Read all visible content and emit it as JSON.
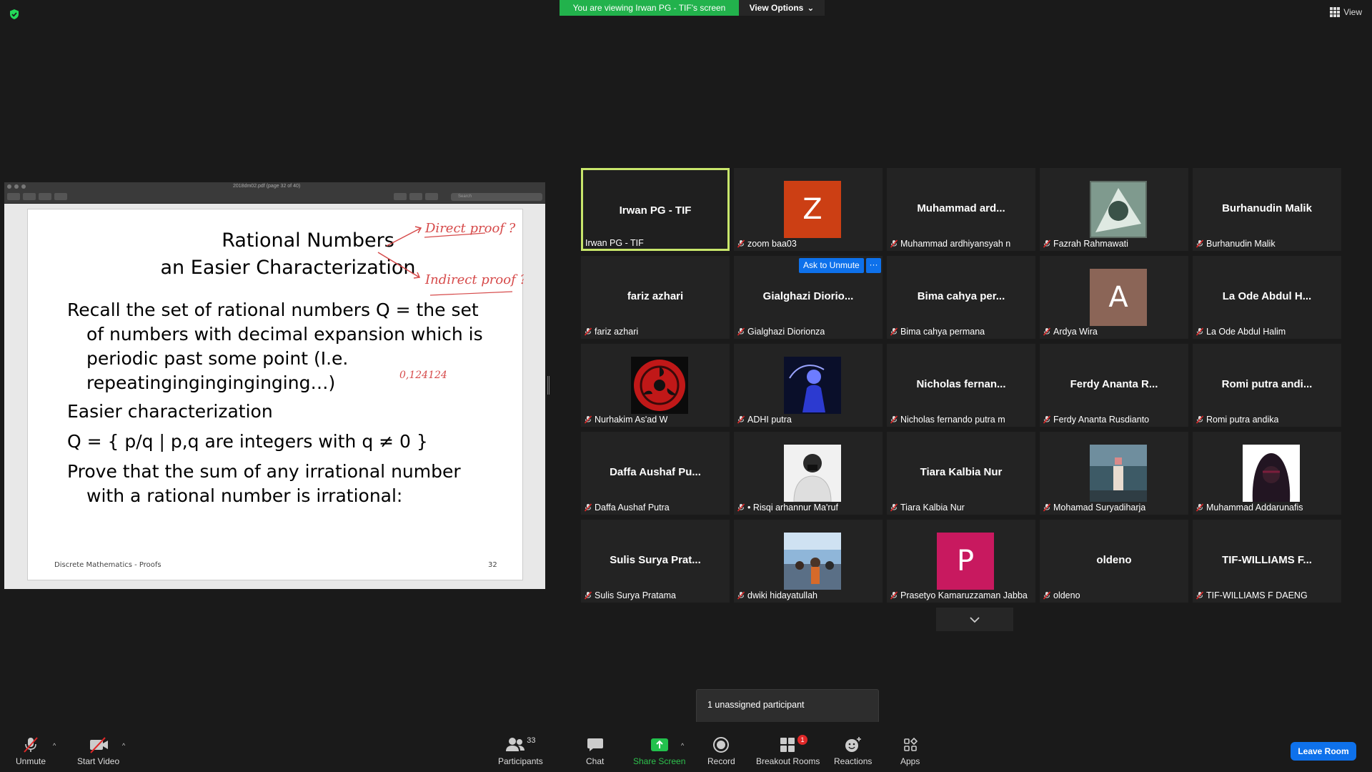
{
  "top": {
    "viewing_banner": "You are viewing Irwan PG - TIF's screen",
    "view_options": "View Options",
    "view": "View"
  },
  "share": {
    "pdf_title": "2018dm02.pdf (page 32 of 40)",
    "pdf_search_placeholder": "Search",
    "slide": {
      "title_line1": "Rational Numbers",
      "title_line2": "an Easier Characterization",
      "lines": [
        "Recall the set of rational numbers Q = the set",
        "of numbers with decimal expansion which is",
        "periodic past some point (I.e.",
        "repeatinginginginginging…)",
        "Easier characterization",
        "Q = { p/q  |  p,q are integers with q ≠ 0 }",
        "Prove that the sum of any irrational number",
        "with a rational number is irrational:"
      ],
      "footer": "Discrete Mathematics - Proofs",
      "page": "32",
      "annotations": [
        "Direct proof ?",
        "Indirect proof ?",
        "0,124124"
      ]
    }
  },
  "gallery": {
    "ask_unmute": "Ask to Unmute",
    "more": "···",
    "tiles": [
      {
        "big": "Irwan PG - TIF",
        "label": "Irwan PG - TIF",
        "muted": false
      },
      {
        "big": "",
        "label": "zoom baa03",
        "avatar": "Z",
        "color": "#cc3f14"
      },
      {
        "big": "Muhammad  ard...",
        "label": "Muhammad ardhiyansyah n"
      },
      {
        "big": "",
        "label": "Fazrah Rahmawati",
        "photo": "art"
      },
      {
        "big": "Burhanudin Malik",
        "label": "Burhanudin Malik"
      },
      {
        "big": "fariz azhari",
        "label": "fariz azhari"
      },
      {
        "big": "Gialghazi  Diorio...",
        "label": "Gialghazi Diorionza"
      },
      {
        "big": "Bima  cahya  per...",
        "label": "Bima cahya permana"
      },
      {
        "big": "",
        "label": "Ardya Wira",
        "avatar": "A",
        "color": "#8b6557"
      },
      {
        "big": "La  Ode  Abdul  H...",
        "label": "La Ode Abdul Halim"
      },
      {
        "big": "",
        "label": "Nurhakim As'ad W",
        "photo": "sharingan"
      },
      {
        "big": "",
        "label": "ADHI putra",
        "photo": "neon"
      },
      {
        "big": "Nicholas  fernan...",
        "label": "Nicholas fernando putra m"
      },
      {
        "big": "Ferdy  Ananta  R...",
        "label": "Ferdy Ananta Rusdianto"
      },
      {
        "big": "Romi  putra  andi...",
        "label": "Romi putra andika"
      },
      {
        "big": "Daffa  Aushaf  Pu...",
        "label": "Daffa Aushaf Putra"
      },
      {
        "big": "",
        "label": "• Risqi arhannur Ma'ruf",
        "photo": "person"
      },
      {
        "big": "Tiara  Kalbia  Nur",
        "label": "Tiara Kalbia Nur"
      },
      {
        "big": "",
        "label": "Mohamad Suryadiharja",
        "photo": "street"
      },
      {
        "big": "",
        "label": "Muhammad Addarunafis",
        "photo": "hood"
      },
      {
        "big": "Sulis  Surya  Prat...",
        "label": "Sulis Surya Pratama"
      },
      {
        "big": "",
        "label": "dwiki hidayatullah",
        "photo": "crowd"
      },
      {
        "big": "",
        "label": "Prasetyo Kamaruzzaman Jabba",
        "avatar": "P",
        "color": "#c8195f"
      },
      {
        "big": "oldeno",
        "label": "oldeno"
      },
      {
        "big": "TIF-WILLIAMS  F...",
        "label": "TIF-WILLIAMS F DAENG"
      }
    ]
  },
  "tooltip": "1 unassigned participant",
  "toolbar": {
    "unmute": "Unmute",
    "start_video": "Start Video",
    "participants": "Participants",
    "participants_count": "33",
    "chat": "Chat",
    "share_screen": "Share Screen",
    "record": "Record",
    "breakout_rooms": "Breakout Rooms",
    "breakout_badge": "1",
    "reactions": "Reactions",
    "apps": "Apps",
    "leave_room": "Leave Room"
  },
  "colors": {
    "banner_green": "#22b24c",
    "active_speaker": "#c8e66b",
    "blue": "#0e71eb",
    "mute_red": "#e02828"
  }
}
